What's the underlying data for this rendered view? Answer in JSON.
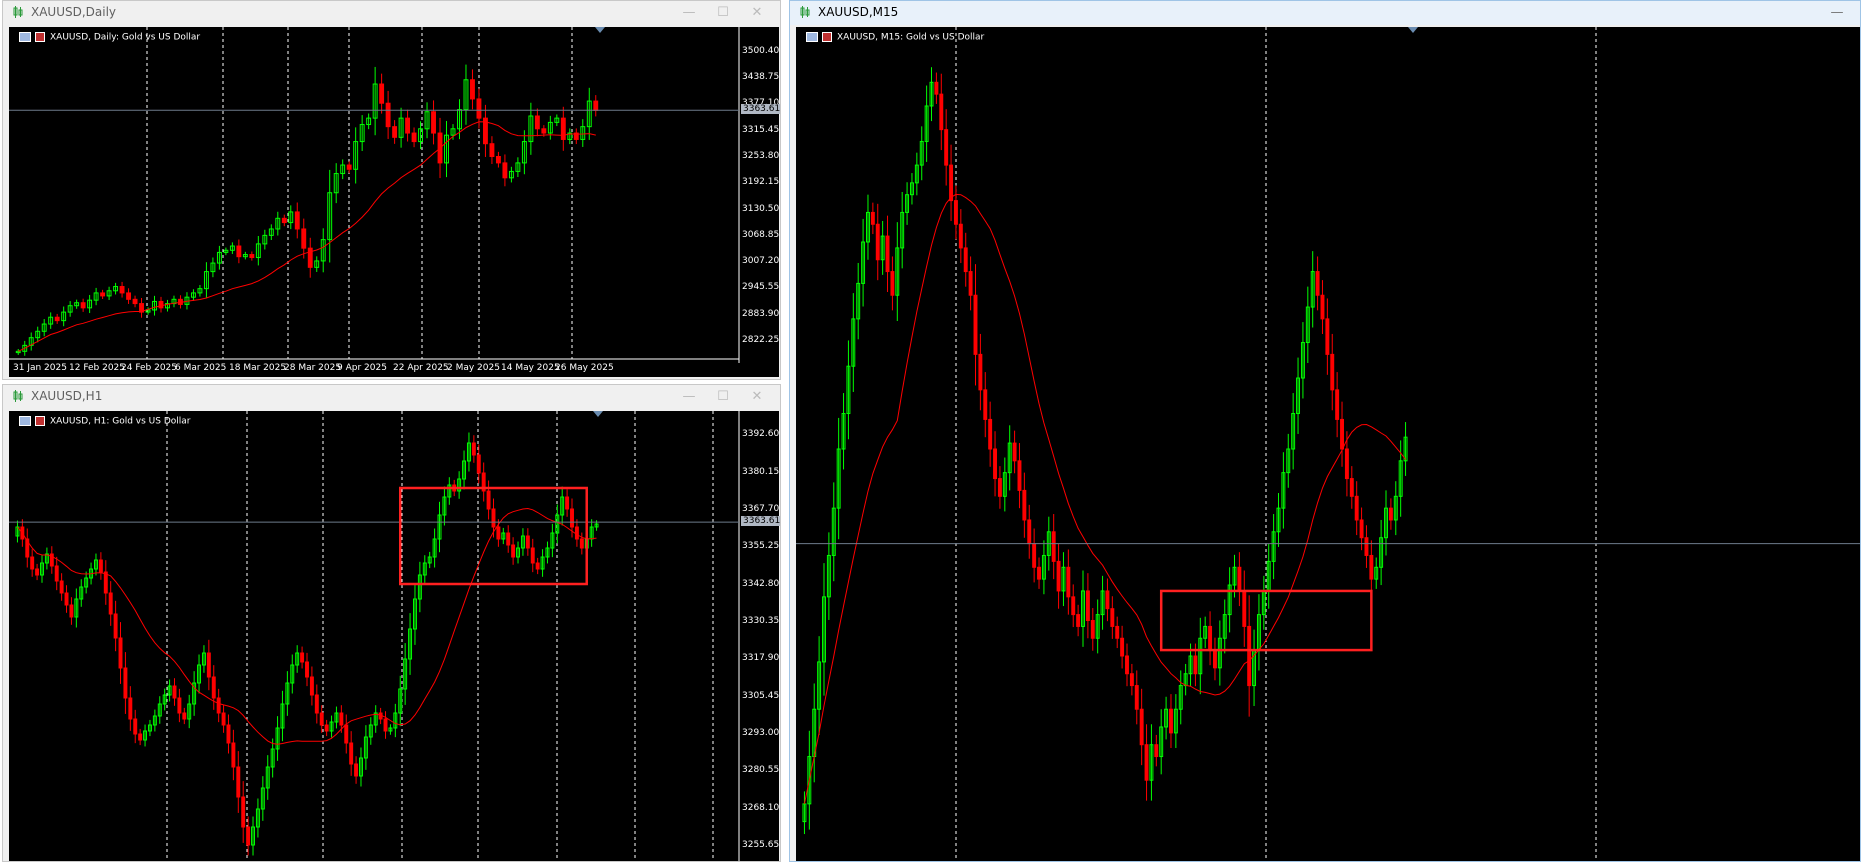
{
  "windows": {
    "daily": {
      "title": "XAUUSD,Daily",
      "header": "XAUUSD, Daily:  Gold vs US Dollar"
    },
    "h1": {
      "title": "XAUUSD,H1",
      "header": "XAUUSD, H1:  Gold vs US Dollar"
    },
    "m15": {
      "title": "XAUUSD,M15",
      "header": "XAUUSD, M15:  Gold vs US Dollar"
    }
  },
  "controls": {
    "minimize": "—",
    "maximize": "☐",
    "close": "✕"
  },
  "colors": {
    "bull": "#00ff00",
    "bear": "#ff0000",
    "ma": "#ff0000",
    "grid": "#ffffff",
    "bid_line": "#6e7b8b",
    "highlight_box": "#ff2020"
  },
  "icons": {
    "title": "chart-candles-icon",
    "header_table": "table-icon",
    "header_flag": "flag-icon"
  },
  "current_price": "3363.61",
  "chart_data": [
    {
      "name": "XAUUSD Daily",
      "type": "candlestick",
      "ylim": [
        2780,
        3540
      ],
      "y_ticks": [
        "3500.40",
        "3438.75",
        "3377.10",
        "3315.45",
        "3253.80",
        "3192.15",
        "3130.50",
        "3068.85",
        "3007.20",
        "2945.55",
        "2883.90",
        "2822.25"
      ],
      "x_ticks": [
        "31 Jan 2025",
        "12 Feb 2025",
        "24 Feb 2025",
        "6 Mar 2025",
        "18 Mar 2025",
        "28 Mar 2025",
        "9 Apr 2025",
        "22 Apr 2025",
        "2 May 2025",
        "14 May 2025",
        "26 May 2025"
      ],
      "close": [
        2798,
        2812,
        2830,
        2845,
        2862,
        2878,
        2870,
        2890,
        2905,
        2912,
        2900,
        2918,
        2935,
        2928,
        2940,
        2950,
        2935,
        2920,
        2910,
        2890,
        2895,
        2915,
        2900,
        2910,
        2920,
        2908,
        2925,
        2935,
        2945,
        2985,
        3005,
        3030,
        3035,
        3045,
        3020,
        3025,
        3018,
        3050,
        3070,
        3085,
        3110,
        3100,
        3125,
        3085,
        3040,
        2995,
        3010,
        3060,
        3170,
        3215,
        3235,
        3225,
        3290,
        3330,
        3345,
        3425,
        3380,
        3325,
        3300,
        3345,
        3310,
        3290,
        3320,
        3360,
        3310,
        3240,
        3305,
        3320,
        3365,
        3435,
        3390,
        3345,
        3285,
        3255,
        3240,
        3205,
        3220,
        3240,
        3290,
        3350,
        3320,
        3310,
        3335,
        3345,
        3295,
        3310,
        3295,
        3325,
        3385,
        3363
      ],
      "ma_period": 20,
      "highlight_boxes": []
    },
    {
      "name": "XAUUSD H1",
      "type": "candlestick",
      "ylim": [
        3250,
        3398
      ],
      "y_ticks": [
        "3392.60",
        "3380.15",
        "3367.70",
        "3355.25",
        "3342.80",
        "3330.35",
        "3317.90",
        "3305.45",
        "3293.00",
        "3280.55",
        "3268.10",
        "3255.65"
      ],
      "close": [
        3362,
        3358,
        3352,
        3348,
        3346,
        3350,
        3353,
        3349,
        3344,
        3340,
        3336,
        3332,
        3338,
        3342,
        3345,
        3348,
        3351,
        3347,
        3340,
        3333,
        3325,
        3315,
        3305,
        3298,
        3293,
        3291,
        3294,
        3296,
        3299,
        3303,
        3306,
        3309,
        3305,
        3300,
        3298,
        3303,
        3310,
        3316,
        3320,
        3312,
        3305,
        3300,
        3296,
        3290,
        3282,
        3272,
        3262,
        3256,
        3262,
        3268,
        3275,
        3282,
        3288,
        3295,
        3303,
        3310,
        3316,
        3320,
        3317,
        3312,
        3306,
        3300,
        3296,
        3294,
        3297,
        3300,
        3296,
        3290,
        3283,
        3279,
        3285,
        3292,
        3296,
        3300,
        3298,
        3294,
        3295,
        3300,
        3308,
        3318,
        3328,
        3338,
        3346,
        3350,
        3352,
        3358,
        3366,
        3372,
        3376,
        3374,
        3378,
        3384,
        3390,
        3386,
        3380,
        3374,
        3368,
        3362,
        3358,
        3360,
        3356,
        3352,
        3355,
        3359,
        3355,
        3350,
        3348,
        3352,
        3355,
        3360,
        3366,
        3372,
        3368,
        3362,
        3358,
        3355,
        3358,
        3362,
        3363
      ],
      "ma_period": 20,
      "highlight_boxes": [
        {
          "from": 3343,
          "to": 3375,
          "start_index": 79,
          "end_index": 115
        }
      ]
    },
    {
      "name": "XAUUSD M15",
      "type": "candlestick",
      "ylim": [
        3280,
        3420
      ],
      "y_ticks": [],
      "close": [
        3290,
        3298,
        3306,
        3314,
        3325,
        3332,
        3340,
        3350,
        3356,
        3364,
        3372,
        3378,
        3385,
        3390,
        3388,
        3382,
        3386,
        3380,
        3376,
        3384,
        3390,
        3393,
        3395,
        3398,
        3402,
        3408,
        3412,
        3410,
        3404,
        3398,
        3392,
        3388,
        3384,
        3380,
        3376,
        3366,
        3360,
        3355,
        3350,
        3345,
        3342,
        3346,
        3351,
        3348,
        3343,
        3338,
        3334,
        3330,
        3328,
        3332,
        3336,
        3331,
        3326,
        3330,
        3325,
        3322,
        3320,
        3326,
        3321,
        3318,
        3322,
        3326,
        3323,
        3320,
        3318,
        3315,
        3312,
        3310,
        3306,
        3300,
        3294,
        3300,
        3298,
        3303,
        3306,
        3302,
        3306,
        3310,
        3312,
        3315,
        3312,
        3318,
        3320,
        3316,
        3313,
        3318,
        3322,
        3327,
        3330,
        3326,
        3320,
        3310,
        3316,
        3322,
        3326,
        3331,
        3336,
        3340,
        3346,
        3350,
        3356,
        3362,
        3368,
        3374,
        3380,
        3376,
        3372,
        3366,
        3360,
        3355,
        3350,
        3345,
        3342,
        3338,
        3335,
        3332,
        3328,
        3330,
        3335,
        3340,
        3338,
        3342,
        3348,
        3352
      ],
      "ma_period": 20,
      "highlight_boxes": [
        {
          "from": 3316,
          "to": 3326,
          "start_index": 74,
          "end_index": 115
        }
      ]
    }
  ]
}
